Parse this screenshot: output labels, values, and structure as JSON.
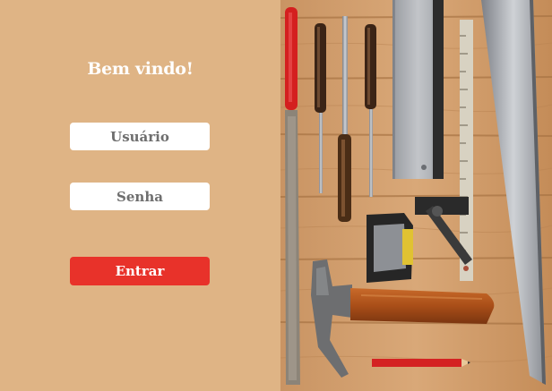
{
  "login": {
    "welcome": "Bem vindo!",
    "username_placeholder": "Usuário",
    "password_placeholder": "Senha",
    "submit_label": "Entrar"
  },
  "colors": {
    "panel_background": "#dfb485",
    "button": "#e8322a",
    "text_light": "#ffffff"
  },
  "image": {
    "subject": "carpentry-tools-on-wood-planks"
  }
}
